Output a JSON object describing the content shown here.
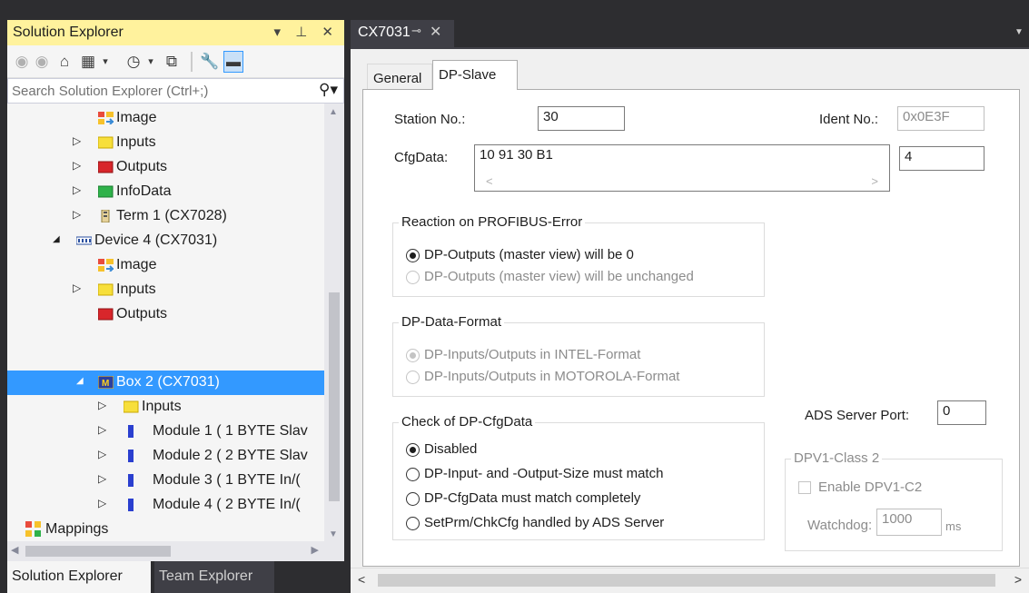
{
  "solution_explorer": {
    "title": "Solution Explorer",
    "title_buttons": "▾ ⊥ ✕",
    "search_placeholder": "Search Solution Explorer (Ctrl+;)",
    "tree": [
      {
        "label": "Image",
        "icon": "image-icon"
      },
      {
        "label": "Inputs",
        "icon": "inputs-icon",
        "expander": "▷"
      },
      {
        "label": "Outputs",
        "icon": "outputs-icon",
        "expander": "▷"
      },
      {
        "label": "InfoData",
        "icon": "infodata-icon",
        "expander": "▷"
      },
      {
        "label": "Term 1 (CX7028)",
        "icon": "terminal-icon",
        "expander": "▷"
      },
      {
        "label": "Device 4 (CX7031)",
        "icon": "device-icon",
        "expander": "◢"
      },
      {
        "label": "Image",
        "icon": "image-icon"
      },
      {
        "label": "Inputs",
        "icon": "inputs-icon",
        "expander": "▷"
      },
      {
        "label": "Outputs",
        "icon": "outputs-icon"
      },
      {
        "label": "Box 2 (CX7031)",
        "icon": "box-icon",
        "expander": "◢",
        "selected": true
      },
      {
        "label": "Inputs",
        "icon": "inputs-icon",
        "expander": "▷"
      },
      {
        "label": "Module 1 ( 1 BYTE Slav",
        "icon": "module-icon",
        "expander": "▷"
      },
      {
        "label": "Module 2 ( 2 BYTE Slav",
        "icon": "module-icon",
        "expander": "▷"
      },
      {
        "label": "Module 3 ( 1 BYTE In/(",
        "icon": "module-icon",
        "expander": "▷"
      },
      {
        "label": "Module 4 ( 2 BYTE In/(",
        "icon": "module-icon",
        "expander": "▷"
      },
      {
        "label": "Mappings",
        "icon": "mappings-icon"
      }
    ],
    "bottom_tabs": [
      "Solution Explorer",
      "Team Explorer"
    ]
  },
  "document": {
    "tab_title": "CX7031",
    "page_tabs": [
      "General",
      "DP-Slave"
    ],
    "active_page_tab": "DP-Slave",
    "station_no_label": "Station No.:",
    "station_no_value": "30",
    "ident_no_label": "Ident No.:",
    "ident_no_value": "0x0E3F",
    "cfgdata_label": "CfgData:",
    "cfgdata_value": "10 91 30 B1",
    "cfgdata_length": "4",
    "reaction_group": {
      "title": "Reaction on PROFIBUS-Error",
      "options": [
        "DP-Outputs (master view) will be 0",
        "DP-Outputs (master view) will be unchanged"
      ],
      "selected": 0
    },
    "format_group": {
      "title": "DP-Data-Format",
      "options": [
        "DP-Inputs/Outputs in INTEL-Format",
        "DP-Inputs/Outputs in MOTOROLA-Format"
      ],
      "selected": 0,
      "disabled": true
    },
    "check_group": {
      "title": "Check of DP-CfgData",
      "options": [
        "Disabled",
        "DP-Input- and -Output-Size must match",
        "DP-CfgData must match completely",
        "SetPrm/ChkCfg handled by ADS Server"
      ],
      "selected": 0
    },
    "ads_server_port_label": "ADS Server Port:",
    "ads_server_port_value": "0",
    "dpv1_group": {
      "title": "DPV1-Class 2",
      "enable_label": "Enable DPV1-C2",
      "watchdog_label": "Watchdog:",
      "watchdog_value": "1000",
      "watchdog_unit": "ms"
    }
  }
}
